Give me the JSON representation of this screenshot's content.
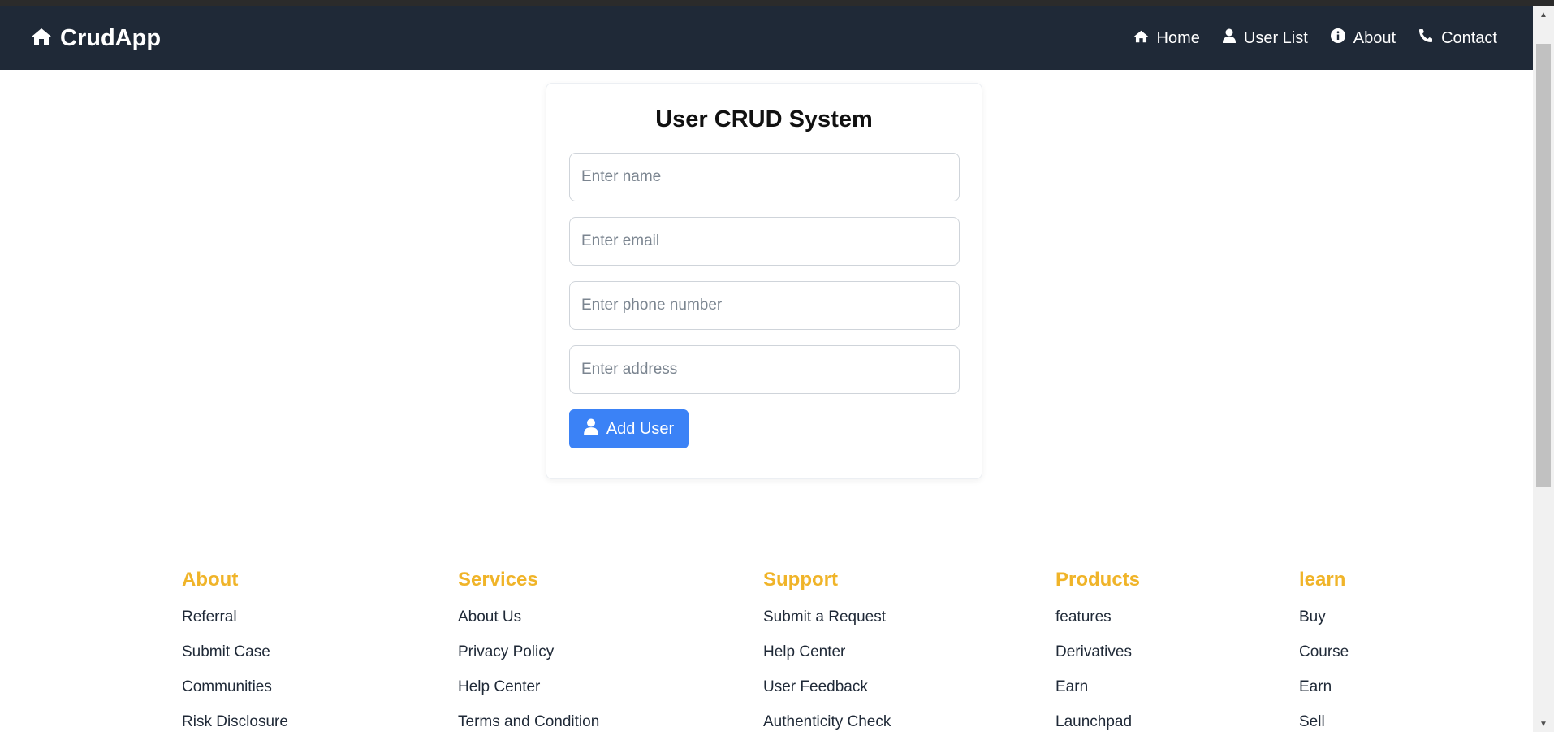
{
  "brand": {
    "name": "CrudApp"
  },
  "nav": {
    "home": "Home",
    "user_list": "User List",
    "about": "About",
    "contact": "Contact"
  },
  "form": {
    "title": "User CRUD System",
    "name_placeholder": "Enter name",
    "email_placeholder": "Enter email",
    "phone_placeholder": "Enter phone number",
    "address_placeholder": "Enter address",
    "submit_label": "Add User"
  },
  "footer": {
    "columns": [
      {
        "heading": "About",
        "links": [
          "Referral",
          "Submit Case",
          "Communities",
          "Risk Disclosure"
        ]
      },
      {
        "heading": "Services",
        "links": [
          "About Us",
          "Privacy Policy",
          "Help Center",
          "Terms and Condition"
        ]
      },
      {
        "heading": "Support",
        "links": [
          "Submit a Request",
          "Help Center",
          "User Feedback",
          "Authenticity Check"
        ]
      },
      {
        "heading": "Products",
        "links": [
          "features",
          "Derivatives",
          "Earn",
          "Launchpad"
        ]
      },
      {
        "heading": "learn",
        "links": [
          "Buy",
          "Course",
          "Earn",
          "Sell"
        ]
      }
    ]
  },
  "colors": {
    "navbar_bg": "#1f2937",
    "accent": "#3b82f6",
    "footer_heading": "#f0b429"
  },
  "icons": {
    "brand": "home-icon",
    "home": "home-icon",
    "user_list": "user-icon",
    "about": "info-circle-icon",
    "contact": "phone-icon",
    "submit": "user-icon"
  }
}
